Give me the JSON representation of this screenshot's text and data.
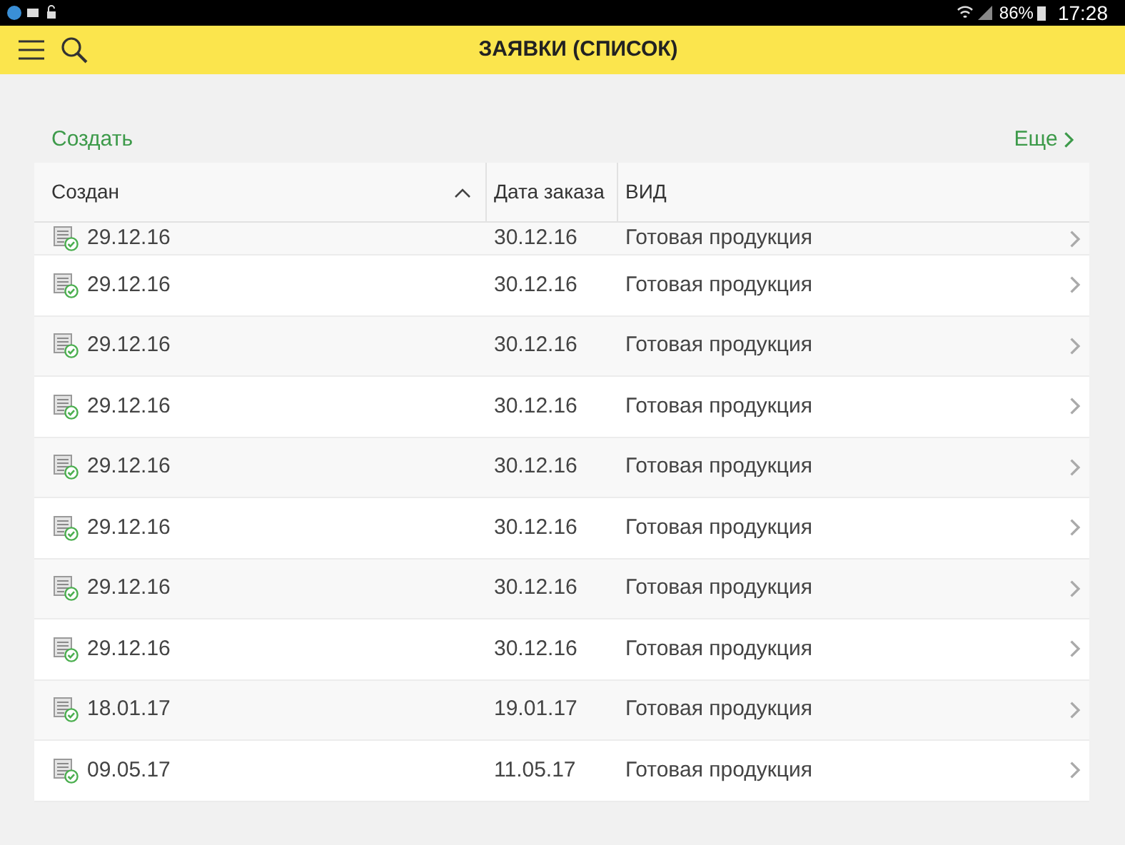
{
  "status_bar": {
    "battery": "86%",
    "time": "17:28"
  },
  "app_bar": {
    "title": "ЗАЯВКИ (СПИСОК)"
  },
  "actions": {
    "create": "Создать",
    "more": "Еще"
  },
  "table": {
    "columns": [
      {
        "label": "Создан",
        "sorted": true
      },
      {
        "label": "Дата заказа",
        "sorted": false
      },
      {
        "label": "ВИД",
        "sorted": false
      }
    ],
    "rows": [
      {
        "created": "29.12.16",
        "order_date": "30.12.16",
        "kind": "Готовая продукция",
        "partial": true
      },
      {
        "created": "29.12.16",
        "order_date": "30.12.16",
        "kind": "Готовая продукция",
        "partial": false
      },
      {
        "created": "29.12.16",
        "order_date": "30.12.16",
        "kind": "Готовая продукция",
        "partial": false
      },
      {
        "created": "29.12.16",
        "order_date": "30.12.16",
        "kind": "Готовая продукция",
        "partial": false
      },
      {
        "created": "29.12.16",
        "order_date": "30.12.16",
        "kind": "Готовая продукция",
        "partial": false
      },
      {
        "created": "29.12.16",
        "order_date": "30.12.16",
        "kind": "Готовая продукция",
        "partial": false
      },
      {
        "created": "29.12.16",
        "order_date": "30.12.16",
        "kind": "Готовая продукция",
        "partial": false
      },
      {
        "created": "29.12.16",
        "order_date": "30.12.16",
        "kind": "Готовая продукция",
        "partial": false
      },
      {
        "created": "18.01.17",
        "order_date": "19.01.17",
        "kind": "Готовая продукция",
        "partial": false
      },
      {
        "created": "09.05.17",
        "order_date": "11.05.17",
        "kind": "Готовая продукция",
        "partial": false
      }
    ]
  }
}
